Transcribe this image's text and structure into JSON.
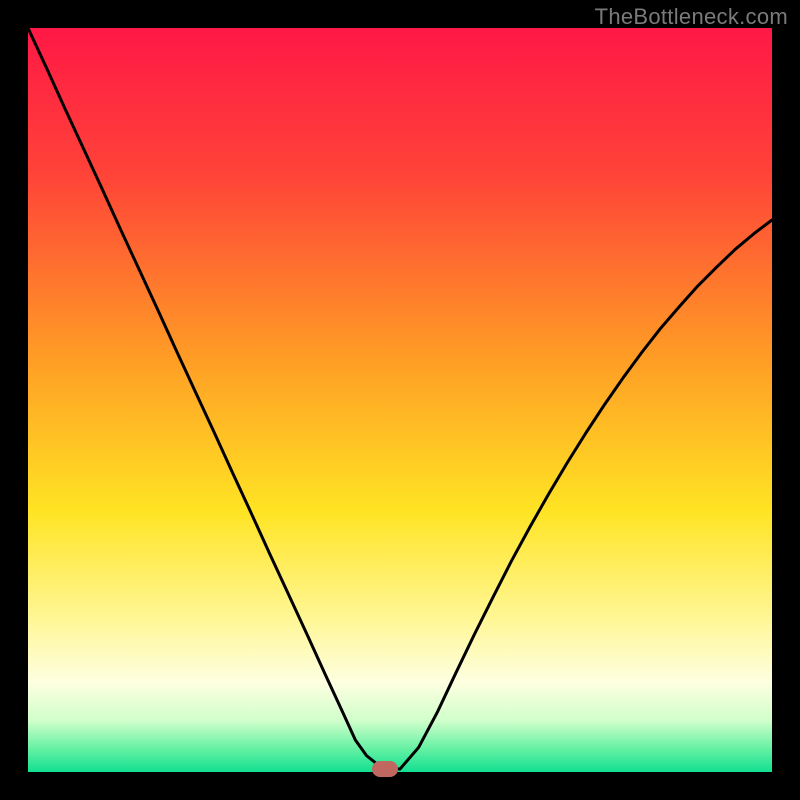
{
  "watermark": {
    "text": "TheBottleneck.com"
  },
  "chart_data": {
    "type": "line",
    "title": "",
    "xlabel": "",
    "ylabel": "",
    "xlim": [
      0,
      100
    ],
    "ylim": [
      0,
      100
    ],
    "grid": false,
    "legend": false,
    "background_gradient": {
      "stops": [
        {
          "offset": 0.0,
          "color": "#ff1846"
        },
        {
          "offset": 0.2,
          "color": "#ff4438"
        },
        {
          "offset": 0.45,
          "color": "#ff9f25"
        },
        {
          "offset": 0.65,
          "color": "#ffe424"
        },
        {
          "offset": 0.8,
          "color": "#fff79a"
        },
        {
          "offset": 0.88,
          "color": "#fdffe1"
        },
        {
          "offset": 0.93,
          "color": "#d2ffcb"
        },
        {
          "offset": 0.97,
          "color": "#62f0a3"
        },
        {
          "offset": 1.0,
          "color": "#12e091"
        }
      ]
    },
    "series": [
      {
        "name": "bottleneck-curve",
        "x": [
          0.0,
          2.5,
          5.0,
          7.5,
          10.0,
          12.5,
          15.0,
          17.5,
          20.0,
          22.5,
          25.0,
          27.5,
          30.0,
          32.5,
          35.0,
          37.5,
          40.0,
          42.5,
          44.0,
          45.5,
          47.0,
          48.5,
          50.0,
          52.5,
          55.0,
          57.5,
          60.0,
          62.5,
          65.0,
          67.5,
          70.0,
          72.5,
          75.0,
          77.5,
          80.0,
          82.5,
          85.0,
          87.5,
          90.0,
          92.5,
          95.0,
          97.5,
          100.0
        ],
        "y": [
          100.0,
          94.6,
          89.1,
          83.7,
          78.3,
          72.8,
          67.4,
          62.0,
          56.5,
          51.1,
          45.7,
          40.2,
          34.8,
          29.3,
          23.9,
          18.5,
          13.0,
          7.6,
          4.3,
          2.2,
          1.0,
          0.4,
          0.4,
          3.3,
          8.0,
          13.3,
          18.5,
          23.5,
          28.4,
          33.0,
          37.4,
          41.6,
          45.6,
          49.4,
          53.0,
          56.4,
          59.6,
          62.5,
          65.3,
          67.8,
          70.2,
          72.3,
          74.2
        ]
      }
    ],
    "marker": {
      "x": 48,
      "y": 0.4,
      "color": "#c0685f"
    }
  }
}
